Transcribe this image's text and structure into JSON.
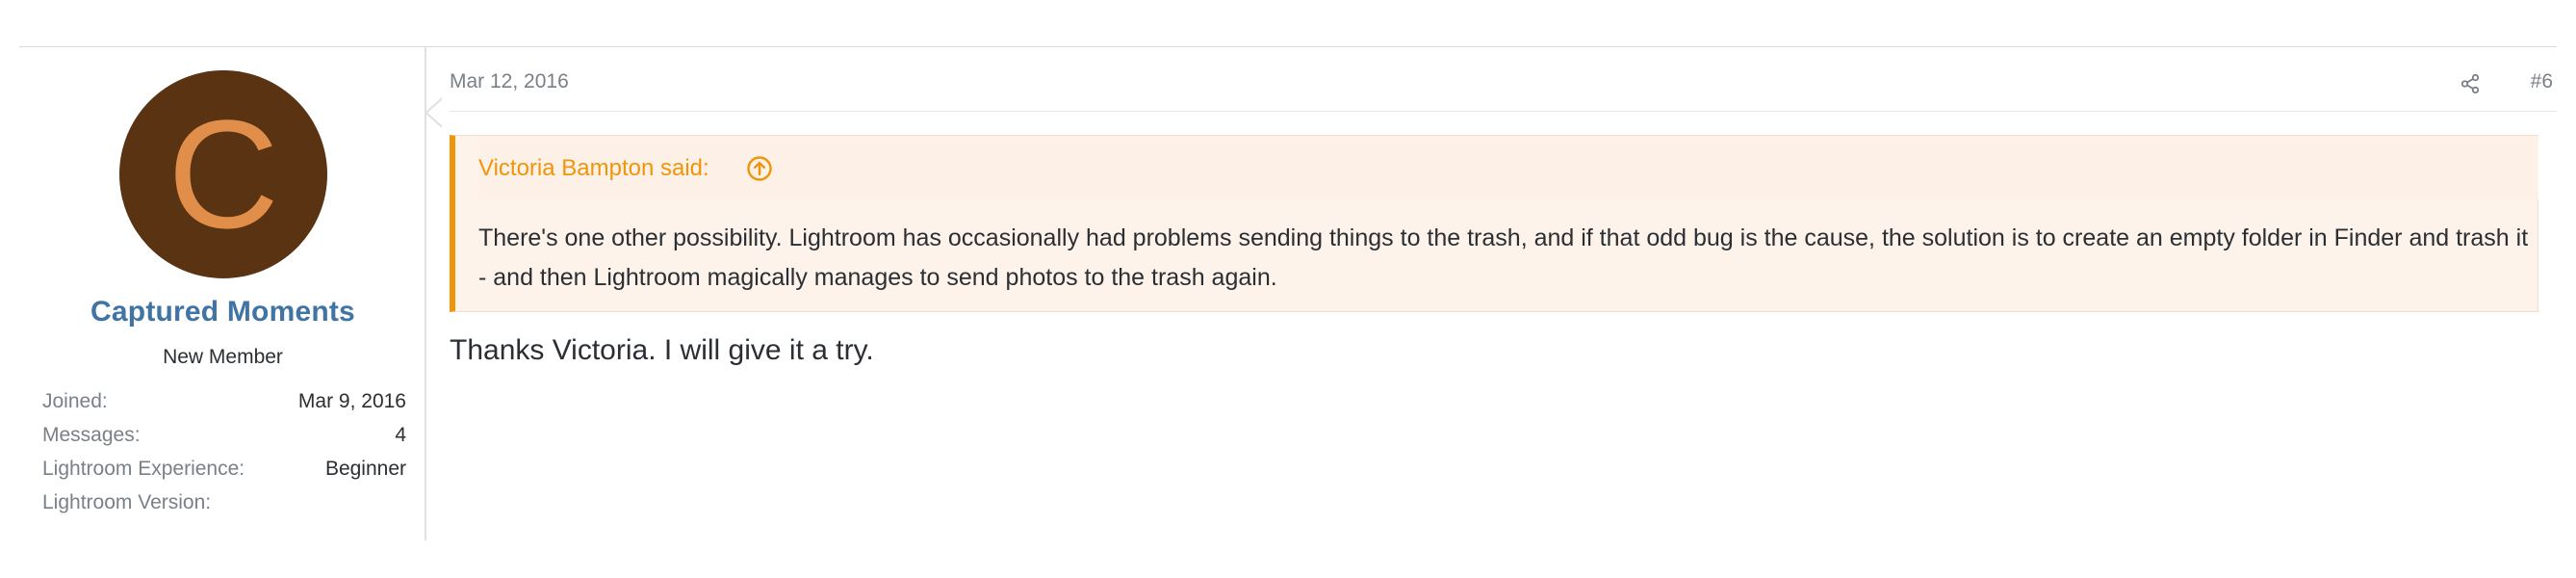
{
  "user": {
    "avatar_letter": "C",
    "avatar_bg": "#5a3412",
    "avatar_fg": "#e08e49",
    "name": "Captured Moments",
    "title": "New Member",
    "extras": [
      {
        "label": "Joined:",
        "value": "Mar 9, 2016"
      },
      {
        "label": "Messages:",
        "value": "4"
      },
      {
        "label": "Lightroom Experience:",
        "value": "Beginner"
      },
      {
        "label": "Lightroom Version:",
        "value": ""
      }
    ]
  },
  "post": {
    "date": "Mar 12, 2016",
    "share_icon": "share-icon",
    "number": "#6",
    "quote": {
      "author_line": "Victoria Bampton said:",
      "jump_icon": "arrow-up-circle-icon",
      "text": "There's one other possibility. Lightroom has occasionally had problems sending things to the trash, and if that odd bug is the cause, the solution is to create an empty folder in Finder and trash it - and then Lightroom magically manages to send photos to the trash again."
    },
    "message": "Thanks Victoria. I will give it a try."
  },
  "colors": {
    "username": "#3f74a3",
    "quote_accent": "#f0940a",
    "quote_bg": "#fdf3eb",
    "muted_text": "#7a8087",
    "body_text": "#2b2f33"
  }
}
